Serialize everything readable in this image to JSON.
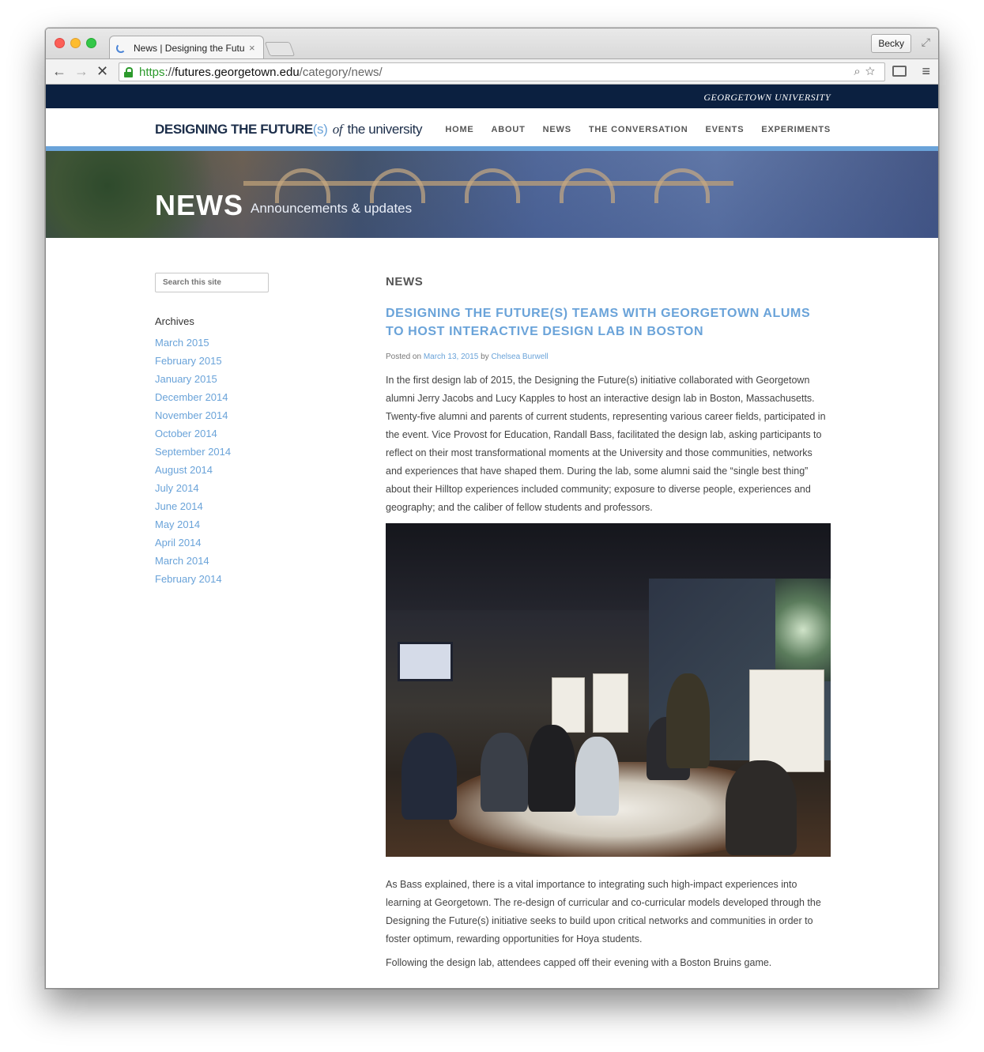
{
  "browser": {
    "tab_title": "News | Designing the Futur",
    "tab_close": "×",
    "profile_name": "Becky",
    "url_scheme": "https",
    "url_sep": "://",
    "url_host": "futures.georgetown.edu",
    "url_path": "/category/news/",
    "nav_back": "←",
    "nav_forward": "→",
    "nav_stop": "✕",
    "omni_icons": "⌕☆",
    "menu": "≡",
    "fullscreen": "⤢"
  },
  "site": {
    "university_name": "GEORGETOWN UNIVERSITY",
    "logo": {
      "part1": "DESIGNING THE FUTURE",
      "paren": "(s)",
      "of": "of",
      "part2": "the university"
    },
    "nav": [
      {
        "label": "HOME"
      },
      {
        "label": "ABOUT"
      },
      {
        "label": "NEWS"
      },
      {
        "label": "THE CONVERSATION"
      },
      {
        "label": "EVENTS"
      },
      {
        "label": "EXPERIMENTS"
      }
    ],
    "accent_color": "#6aa3d9",
    "navy_color": "#0b2040"
  },
  "hero": {
    "title": "NEWS",
    "subtitle": "Announcements & updates"
  },
  "sidebar": {
    "search_placeholder": "Search this site",
    "archives_title": "Archives",
    "archives": [
      {
        "label": "March 2015"
      },
      {
        "label": "February 2015"
      },
      {
        "label": "January 2015"
      },
      {
        "label": "December 2014"
      },
      {
        "label": "November 2014"
      },
      {
        "label": "October 2014"
      },
      {
        "label": "September 2014"
      },
      {
        "label": "August 2014"
      },
      {
        "label": "July 2014"
      },
      {
        "label": "June 2014"
      },
      {
        "label": "May 2014"
      },
      {
        "label": "April 2014"
      },
      {
        "label": "March 2014"
      },
      {
        "label": "February 2014"
      }
    ]
  },
  "main": {
    "section_heading": "NEWS",
    "post": {
      "title": "DESIGNING THE FUTURE(S) TEAMS WITH GEORGETOWN ALUMS TO HOST INTERACTIVE DESIGN LAB IN BOSTON",
      "meta_prefix": "Posted on",
      "date": "March 13, 2015",
      "meta_by": "by",
      "author": "Chelsea Burwell",
      "paragraph1": "In the first design lab of 2015, the Designing the Future(s) initiative collaborated with Georgetown alumni Jerry Jacobs and Lucy Kapples to host an interactive design lab in Boston, Massachusetts. Twenty-five alumni and parents of current students, representing various career fields, participated in the event. Vice Provost for Education, Randall Bass, facilitated the design lab, asking participants to reflect on their most transformational moments at the University and those communities, networks and experiences that have shaped them. During the lab, some alumni said the “single best thing” about their Hilltop experiences included community; exposure to diverse people, experiences and geography; and the caliber of fellow students and professors.",
      "paragraph2": "As Bass explained, there is a vital importance to integrating such high-impact experiences into learning at Georgetown. The re-design of curricular and co-curricular models developed through the Designing the Future(s) initiative seeks to build upon critical networks and communities in order to foster optimum, rewarding opportunities for Hoya students.",
      "paragraph3": "Following the design lab, attendees capped off their evening with a Boston Bruins game."
    }
  }
}
